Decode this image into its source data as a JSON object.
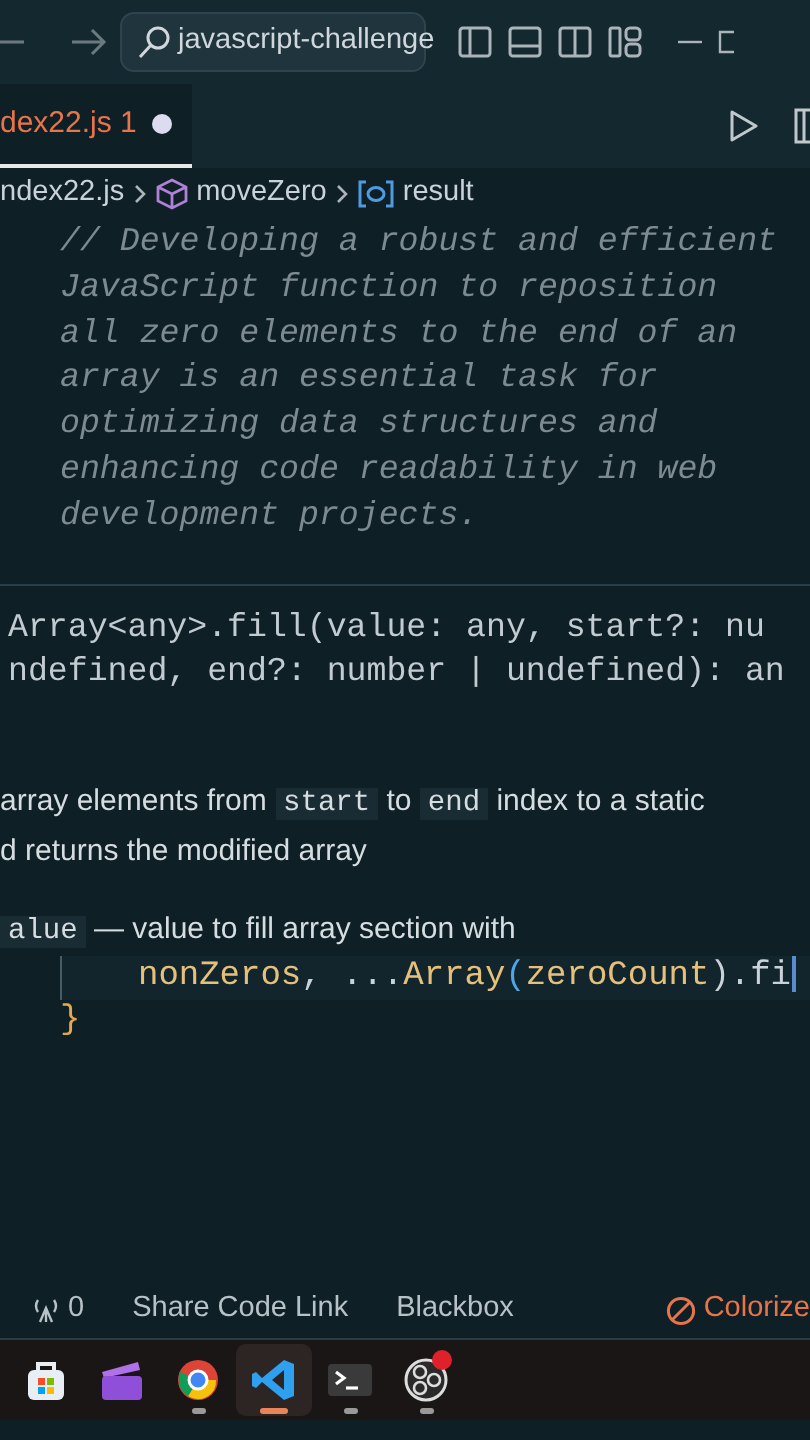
{
  "title_bar": {
    "search": {
      "value": "javascript-challenge"
    }
  },
  "tabs": [
    {
      "label": "dex22.js",
      "problems": "1",
      "modified": true,
      "selected": true
    }
  ],
  "breadcrumbs": [
    {
      "label": "ndex22.js",
      "kind": "file"
    },
    {
      "label": "moveZero",
      "kind": "function"
    },
    {
      "label": "result",
      "kind": "variable"
    }
  ],
  "comment_lines": [
    "// Developing a robust and efficient",
    "JavaScript function to reposition",
    "all zero elements to the end of an",
    "array is an essential task for",
    "optimizing data structures and",
    "enhancing code readability in web",
    "development projects."
  ],
  "hover": {
    "signature_lines": [
      "Array<any>.fill(value: any, start?: nu",
      "ndefined, end?: number | undefined): an"
    ],
    "description": [
      [
        {
          "text": "array elements from ",
          "kind": "text"
        },
        {
          "text": "start",
          "kind": "code"
        },
        {
          "text": " to ",
          "kind": "text"
        },
        {
          "text": "end",
          "kind": "code"
        },
        {
          "text": " index to a static",
          "kind": "text"
        }
      ],
      [
        {
          "text": "d returns the modified array",
          "kind": "text"
        }
      ]
    ],
    "param": [
      {
        "text": "alue",
        "kind": "code"
      },
      {
        "text": " — value to fill array section with",
        "kind": "text"
      }
    ]
  },
  "code_lines": [
    [
      {
        "text": "nonZeros",
        "kind": "variable"
      },
      {
        "text": ", ...",
        "kind": "punct"
      },
      {
        "text": "Array",
        "kind": "variable"
      },
      {
        "text": "(",
        "kind": "bracket"
      },
      {
        "text": "zeroCount",
        "kind": "variable"
      },
      {
        "text": ").fi",
        "kind": "punct"
      }
    ],
    [
      {
        "text": "}",
        "kind": "brace"
      }
    ]
  ],
  "status_bar": [
    {
      "kind": "ports",
      "label": "0"
    },
    {
      "kind": "plain",
      "label": "Share Code Link"
    },
    {
      "kind": "plain",
      "label": "Blackbox"
    },
    {
      "kind": "warning",
      "label": "Colorize"
    }
  ],
  "taskbar": [
    {
      "kind": "store",
      "running": false,
      "selected": false,
      "badge": false
    },
    {
      "kind": "clapper",
      "running": false,
      "selected": false,
      "badge": false
    },
    {
      "kind": "browser",
      "running": true,
      "selected": false,
      "badge": false
    },
    {
      "kind": "editor",
      "running": true,
      "selected": true,
      "badge": false
    },
    {
      "kind": "terminal",
      "running": true,
      "selected": false,
      "badge": false
    },
    {
      "kind": "recorder",
      "running": true,
      "selected": false,
      "badge": true
    }
  ]
}
